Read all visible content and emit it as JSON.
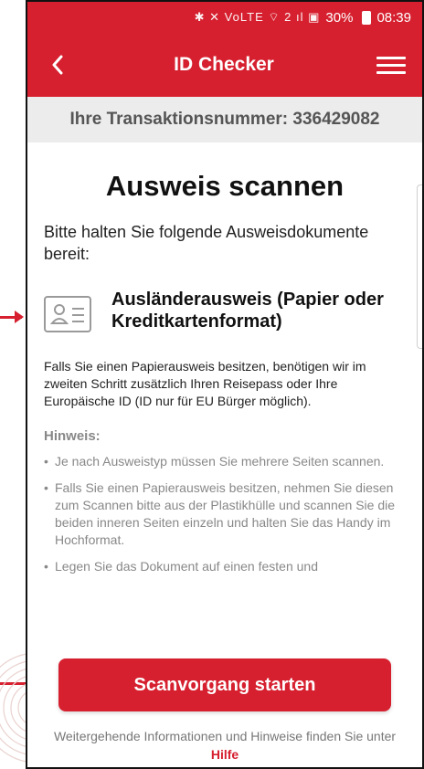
{
  "statusbar": {
    "icons": "✱ ✕ VoLTE ⌔ 2 ıl ▣",
    "battery_pct": "30%",
    "time": "08:39"
  },
  "appbar": {
    "title": "ID Checker",
    "back_icon": "chevron-left-icon",
    "menu_icon": "hamburger-menu-icon"
  },
  "transaction": {
    "label": "Ihre Transaktionsnummer: 336429082"
  },
  "main": {
    "heading": "Ausweis scannen",
    "intro": "Bitte halten Sie folgende Ausweisdokumente bereit:",
    "document": {
      "icon": "id-card-icon",
      "label": "Ausländerausweis (Papier oder Kreditkartenformat)"
    },
    "paragraph": "Falls Sie einen Papierausweis besitzen, benötigen wir im zweiten Schritt zusätzlich Ihren Reisepass oder Ihre Europäische ID (ID nur für EU Bürger möglich).",
    "hint_title": "Hinweis:",
    "hints": [
      "Je nach Ausweistyp müssen Sie mehrere Seiten scannen.",
      "Falls Sie einen Papierausweis besitzen, nehmen Sie diesen zum Scannen bitte aus der Plastikhülle und scannen Sie die beiden inneren Seiten einzeln und halten Sie das Handy im Hochformat.",
      "Legen Sie das Dokument auf einen festen und"
    ]
  },
  "cta": {
    "label": "Scanvorgang starten"
  },
  "footer": {
    "text": "Weitergehende Informationen und Hinweise finden Sie unter",
    "link": "Hilfe"
  },
  "colors": {
    "brand": "#d6202f",
    "muted": "#888888"
  }
}
